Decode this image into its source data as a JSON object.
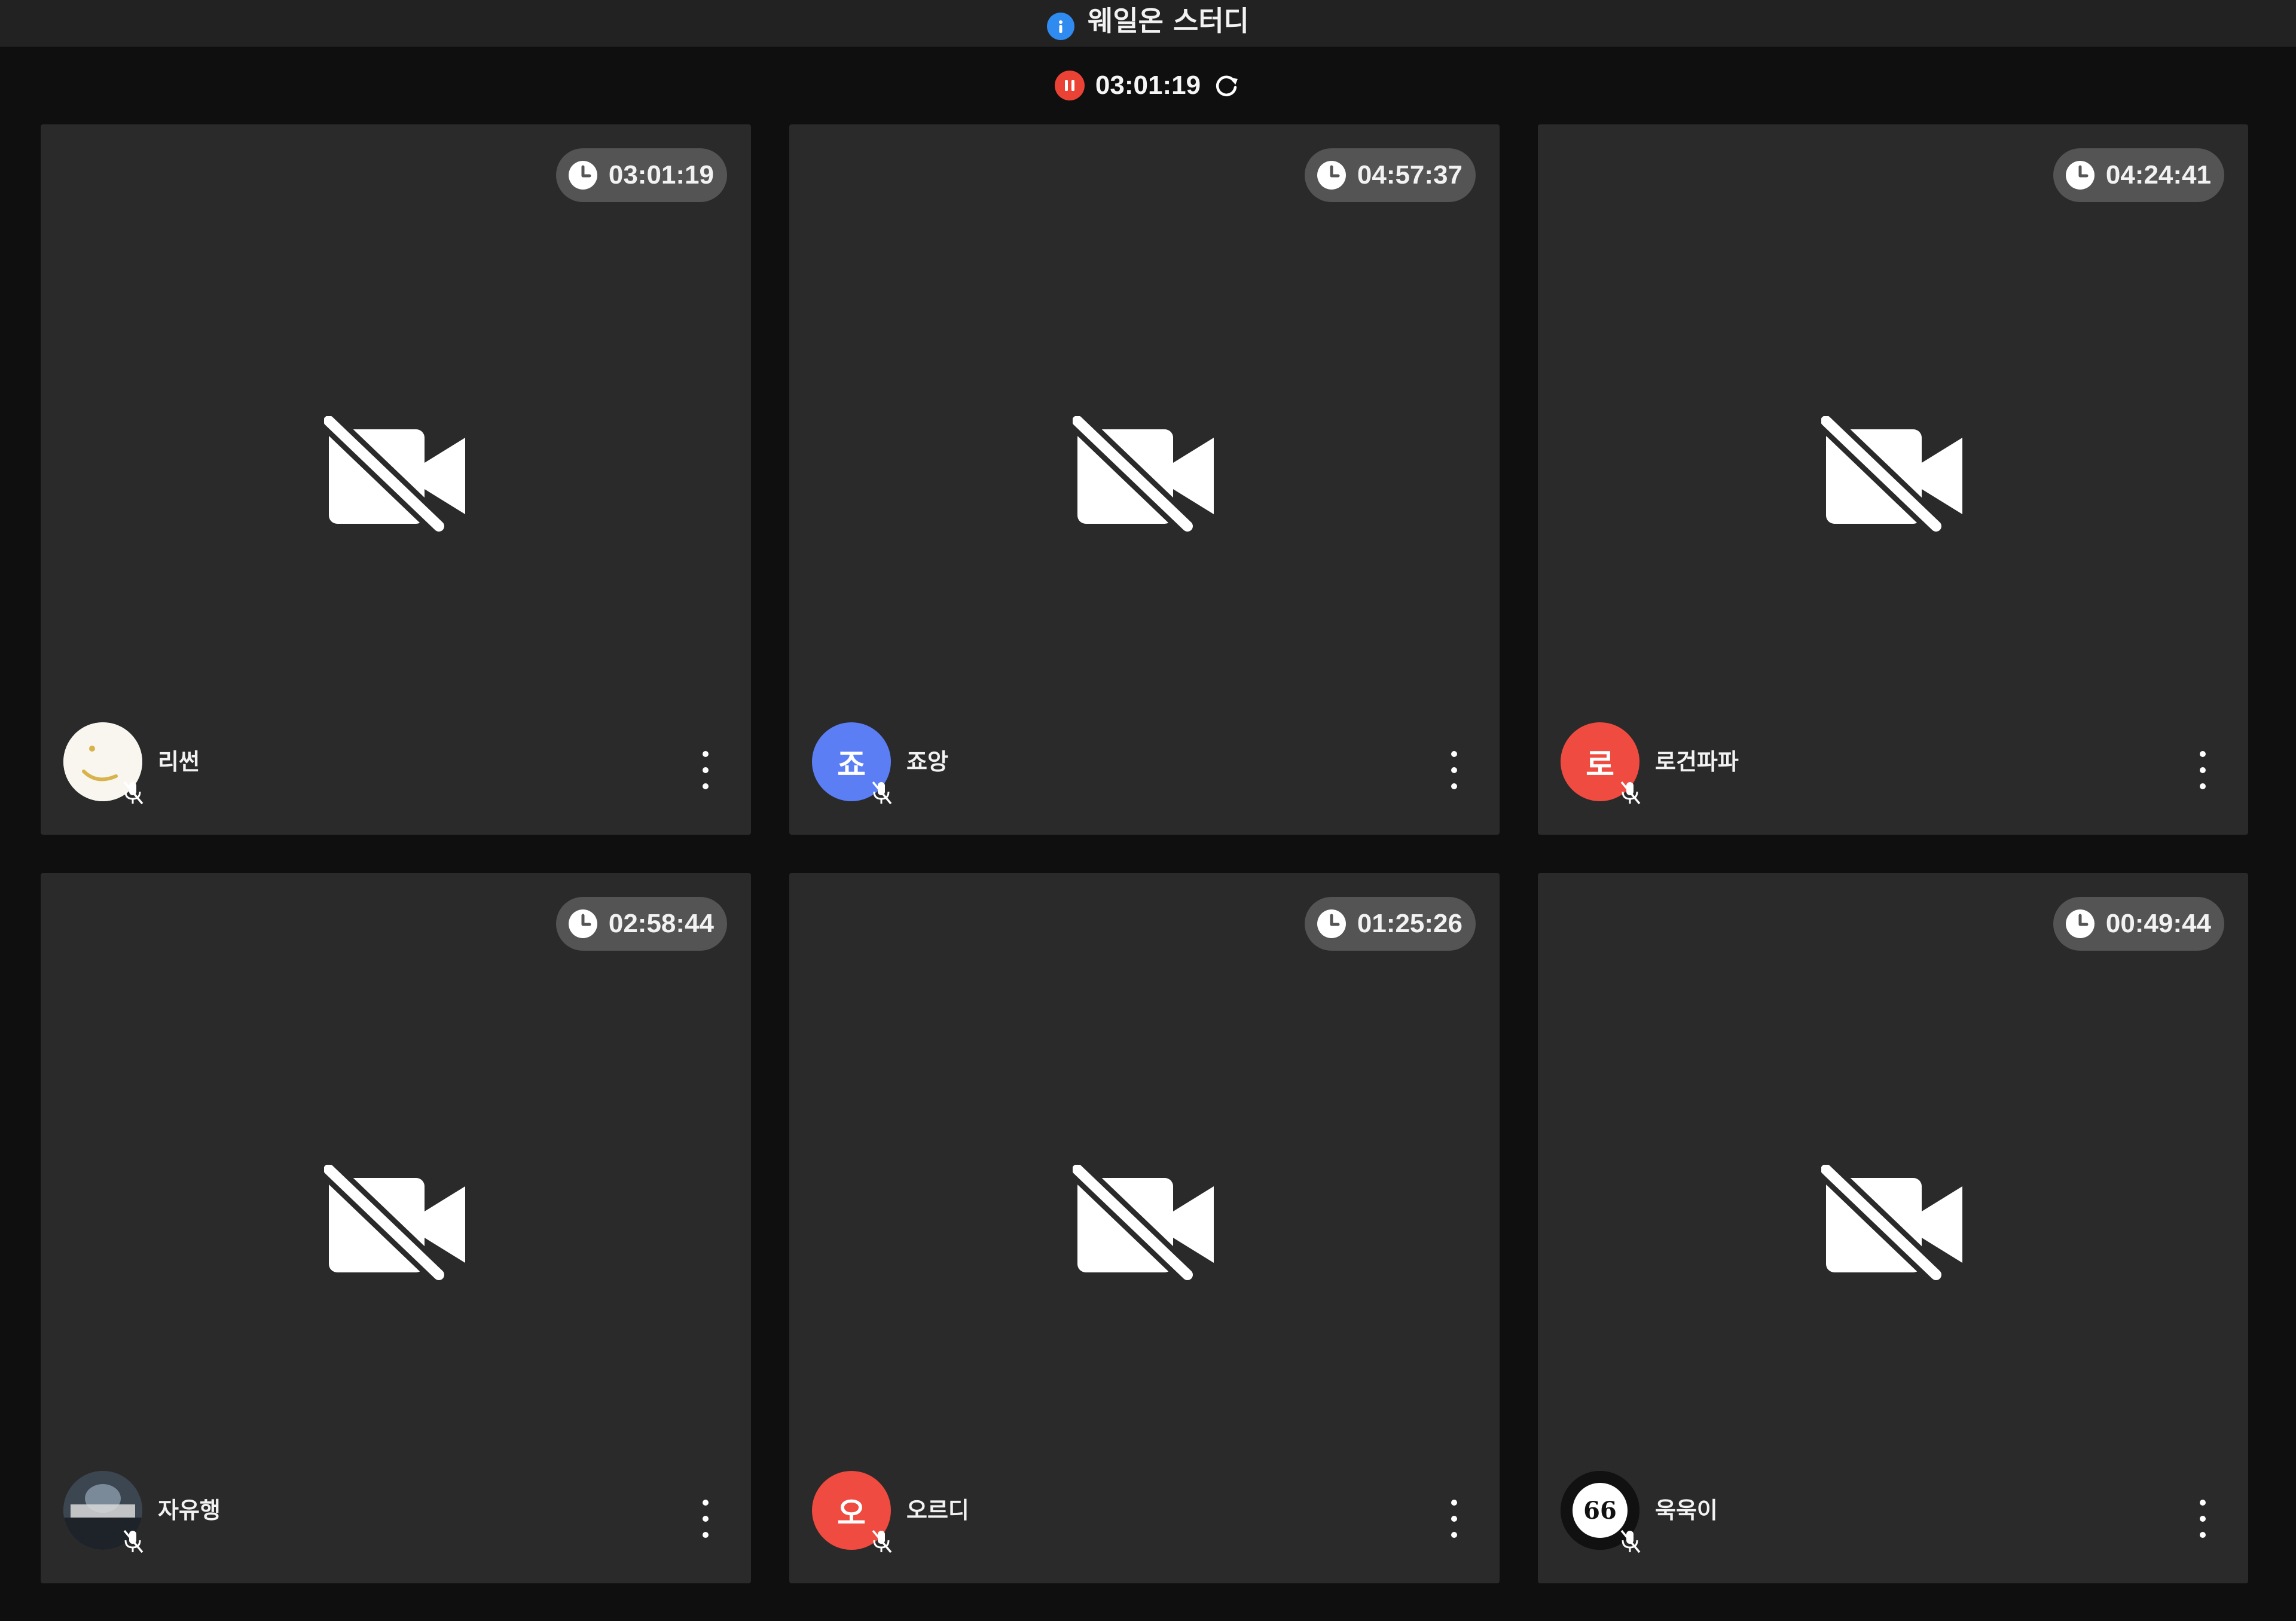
{
  "room": {
    "title": "웨일온 스터디",
    "info_icon": "info-icon"
  },
  "session": {
    "elapsed": "03:01:19",
    "pause_icon": "pause-icon",
    "refresh_icon": "refresh-icon",
    "pause_color": "#ea4335"
  },
  "participants": [
    {
      "name": "리썬",
      "time": "03:01:19",
      "avatar_text": "",
      "avatar_type": "image-logo",
      "avatar_color": "#f8f6ef"
    },
    {
      "name": "죠앙",
      "time": "04:57:37",
      "avatar_text": "죠",
      "avatar_type": "initial",
      "avatar_color": "#5b7ef5"
    },
    {
      "name": "로건파파",
      "time": "04:24:41",
      "avatar_text": "로",
      "avatar_type": "initial",
      "avatar_color": "#ef4b40"
    },
    {
      "name": "자유행",
      "time": "02:58:44",
      "avatar_text": "",
      "avatar_type": "image-photo",
      "avatar_color": "#4a5560"
    },
    {
      "name": "오르디",
      "time": "01:25:26",
      "avatar_text": "오",
      "avatar_type": "initial",
      "avatar_color": "#ef4b40"
    },
    {
      "name": "욱욱이",
      "time": "00:49:44",
      "avatar_text": "",
      "avatar_type": "image-66",
      "avatar_color": "#111111"
    }
  ],
  "icons": {
    "camera_off": "video-off-icon",
    "mic_off": "mic-off-icon",
    "clock": "clock-icon",
    "more": "more-vertical-icon"
  }
}
